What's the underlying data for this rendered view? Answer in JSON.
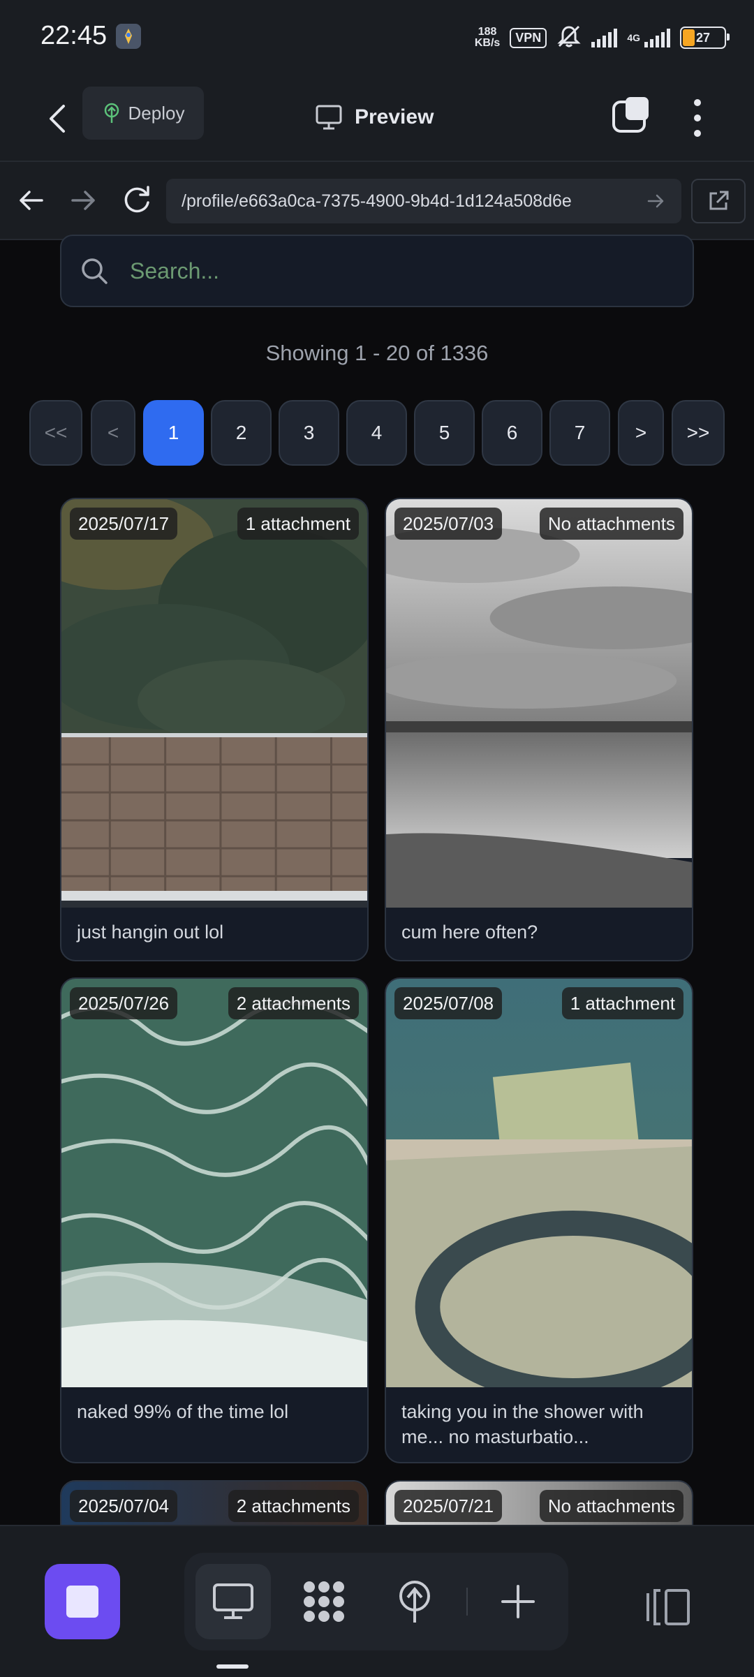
{
  "status_bar": {
    "time": "22:45",
    "net_speed_value": "188",
    "net_speed_unit": "KB/s",
    "vpn": "VPN",
    "network_type": "4G",
    "battery": "27",
    "battery_color": "#f6a623"
  },
  "header": {
    "deploy_label": "Deploy",
    "preview_label": "Preview",
    "icons": [
      "back-arrow-icon",
      "deploy-tree-icon",
      "monitor-icon",
      "tabs-icon",
      "more-vertical-icon"
    ]
  },
  "browser": {
    "url": "/profile/e663a0ca-7375-4900-9b4d-1d124a508d6e",
    "icons": [
      "back-icon",
      "forward-icon",
      "reload-icon",
      "go-arrow-icon",
      "open-external-icon"
    ]
  },
  "search": {
    "placeholder": "Search..."
  },
  "showing_text": "Showing 1 - 20 of 1336",
  "pagination": {
    "first": "<<",
    "prev": "<",
    "pages": [
      "1",
      "2",
      "3",
      "4",
      "5",
      "6",
      "7"
    ],
    "current": "1",
    "next": ">",
    "last": ">>",
    "active_color": "#2f6bf0"
  },
  "cards": [
    {
      "date": "2025/07/17",
      "attachments": "1 attachment",
      "caption": "just hangin out lol"
    },
    {
      "date": "2025/07/03",
      "attachments": "No attachments",
      "caption": "cum here often?"
    },
    {
      "date": "2025/07/26",
      "attachments": "2 attachments",
      "caption": "naked 99% of the time lol"
    },
    {
      "date": "2025/07/08",
      "attachments": "1 attachment",
      "caption": "taking you in the shower with me... no masturbatio..."
    },
    {
      "date": "2025/07/04",
      "attachments": "2 attachments",
      "caption": ""
    },
    {
      "date": "2025/07/21",
      "attachments": "No attachments",
      "caption": ""
    }
  ],
  "bottom_nav": {
    "stop_button_color": "#6c4cf1",
    "icons": [
      "stop-icon",
      "desktop-icon",
      "grid-icon",
      "deploy-icon",
      "plus-icon",
      "panel-icon"
    ]
  }
}
